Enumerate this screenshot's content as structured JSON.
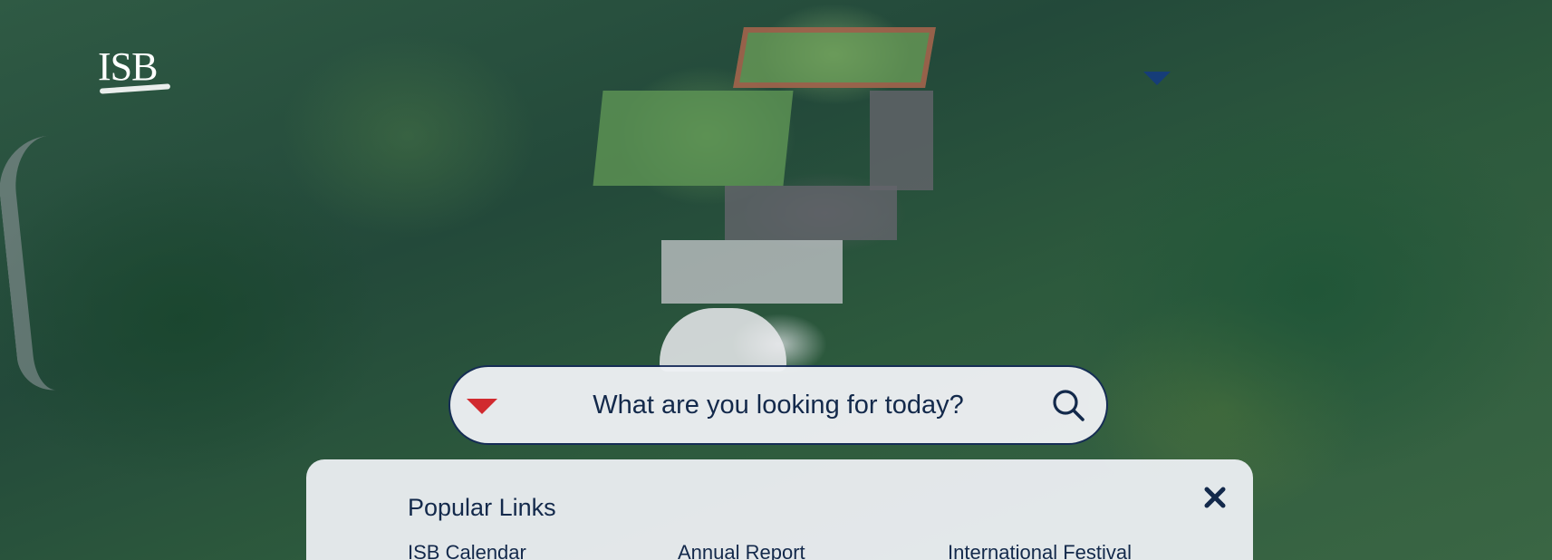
{
  "logo": {
    "text": "ISB"
  },
  "search": {
    "placeholder": "What are you looking for today?",
    "toggle_icon": "triangle-down-icon",
    "search_icon": "magnifier-icon"
  },
  "popular_links": {
    "title": "Popular Links",
    "close_icon": "close-x-icon",
    "links": [
      {
        "label": "ISB Calendar"
      },
      {
        "label": "Annual Report"
      },
      {
        "label": "International Festival"
      }
    ]
  },
  "colors": {
    "brand_navy": "#13294b",
    "accent_red": "#d12a2f",
    "nav_marker": "#163d78"
  }
}
